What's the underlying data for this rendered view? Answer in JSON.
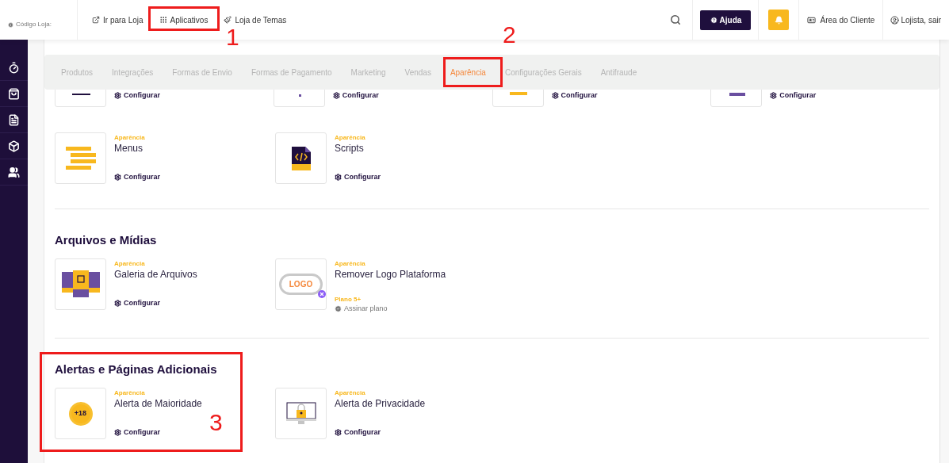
{
  "header": {
    "store_code": "Código Loja:",
    "nav": [
      {
        "label": "Ir para Loja"
      },
      {
        "label": "Aplicativos"
      },
      {
        "label": "Loja de Temas"
      }
    ],
    "help_button": "Ajuda",
    "client_area": "Área do Cliente",
    "user": "Lojista, sair"
  },
  "tabs": [
    {
      "label": "Produtos",
      "selected": false
    },
    {
      "label": "Integrações",
      "selected": false
    },
    {
      "label": "Formas de Envio",
      "selected": false
    },
    {
      "label": "Formas de Pagamento",
      "selected": false
    },
    {
      "label": "Marketing",
      "selected": false
    },
    {
      "label": "Vendas",
      "selected": false
    },
    {
      "label": "Aparência",
      "selected": true
    },
    {
      "label": "Configurações Gerais",
      "selected": false
    },
    {
      "label": "Antifraude",
      "selected": false
    }
  ],
  "cut_row": [
    {
      "kind": "dark-bar",
      "action": "Configurar"
    },
    {
      "kind": "purple-dot",
      "action": "Configurar"
    },
    {
      "kind": "yellow-bar",
      "action": "Configurar"
    },
    {
      "kind": "purple-bar",
      "action": "Configurar"
    }
  ],
  "sections": [
    {
      "items": [
        {
          "kind": "menus",
          "category": "Aparência",
          "name": "Menus",
          "action": "Configurar"
        },
        {
          "kind": "scripts",
          "category": "Aparência",
          "name": "Scripts",
          "action": "Configurar"
        }
      ]
    },
    {
      "title": "Arquivos e Mídias",
      "items": [
        {
          "kind": "gallery",
          "category": "Aparência",
          "name": "Galeria de Arquivos",
          "action": "Configurar"
        },
        {
          "kind": "logo",
          "icon_text": "LOGO",
          "category": "Aparência",
          "name": "Remover Logo Plataforma",
          "plan": "Plano 5+",
          "action": "Assinar plano"
        }
      ]
    },
    {
      "title": "Alertas e Páginas Adicionais",
      "items": [
        {
          "kind": "age",
          "icon_text": "+18",
          "category": "Aparência",
          "name": "Alerta de Maioridade",
          "action": "Configurar"
        },
        {
          "kind": "privacy",
          "category": "Aparência",
          "name": "Alerta de Privacidade",
          "action": "Configurar"
        }
      ]
    }
  ],
  "annotations": [
    {
      "label": "1"
    },
    {
      "label": "2"
    },
    {
      "label": "3"
    }
  ]
}
